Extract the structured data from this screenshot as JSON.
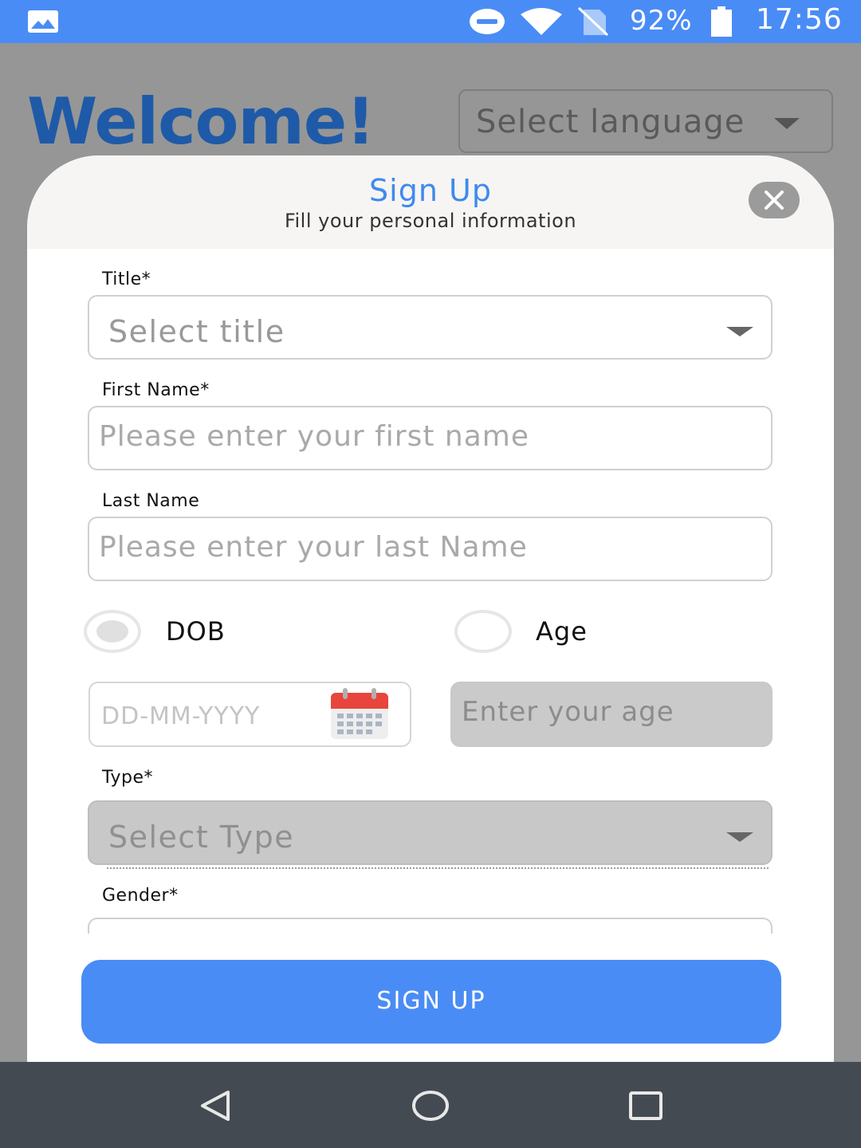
{
  "status_bar": {
    "battery_percent": "92%",
    "time": "17:56",
    "icons": [
      "gallery-icon",
      "do-not-disturb-icon",
      "wifi-icon",
      "no-sim-icon",
      "battery-icon"
    ]
  },
  "page": {
    "welcome": "Welcome!",
    "language_placeholder": "Select language"
  },
  "modal": {
    "title": "Sign Up",
    "subtitle": "Fill your personal information",
    "fields": {
      "title_label": "Title*",
      "title_placeholder": "Select title",
      "first_name_label": "First Name*",
      "first_name_placeholder": "Please enter your first name",
      "last_name_label": "Last Name",
      "last_name_placeholder": "Please enter your last Name",
      "dob_option": "DOB",
      "age_option": "Age",
      "date_placeholder": "DD-MM-YYYY",
      "age_placeholder": "Enter your age",
      "type_label": "Type*",
      "type_placeholder": "Select Type",
      "gender_label": "Gender*"
    },
    "signup_button": "SIGN UP"
  },
  "colors": {
    "accent": "#4a8cf5",
    "welcome": "#1e5aa8",
    "navbar": "#444a51"
  }
}
